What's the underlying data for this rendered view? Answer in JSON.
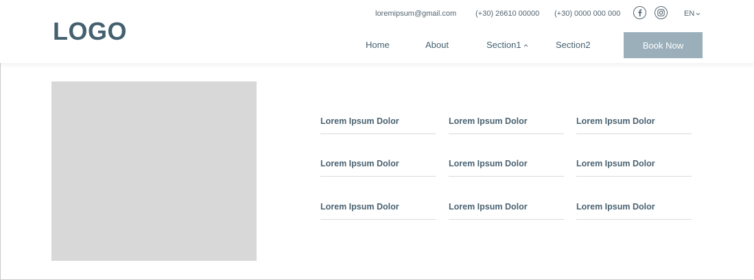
{
  "header": {
    "logo": "LOGO",
    "email": "loremipsum@gmail.com",
    "phone1": "(+30) 26610 00000",
    "phone2": "(+30) 0000 000 000",
    "language": "EN",
    "social_icons": [
      "facebook-icon",
      "instagram-icon"
    ],
    "nav": {
      "home": "Home",
      "about": "About",
      "section1": "Section1",
      "section2": "Section2"
    },
    "book_label": "Book Now"
  },
  "links": {
    "row1": [
      "Lorem Ipsum Dolor",
      "Lorem Ipsum Dolor",
      "Lorem Ipsum Dolor"
    ],
    "row2": [
      "Lorem Ipsum Dolor",
      "Lorem Ipsum Dolor",
      "Lorem Ipsum Dolor"
    ],
    "row3": [
      "Lorem Ipsum Dolor",
      "Lorem Ipsum Dolor",
      "Lorem Ipsum Dolor"
    ]
  },
  "colors": {
    "brand": "#44606f",
    "button": "#9aafba",
    "placeholder": "#d8d8d8"
  }
}
